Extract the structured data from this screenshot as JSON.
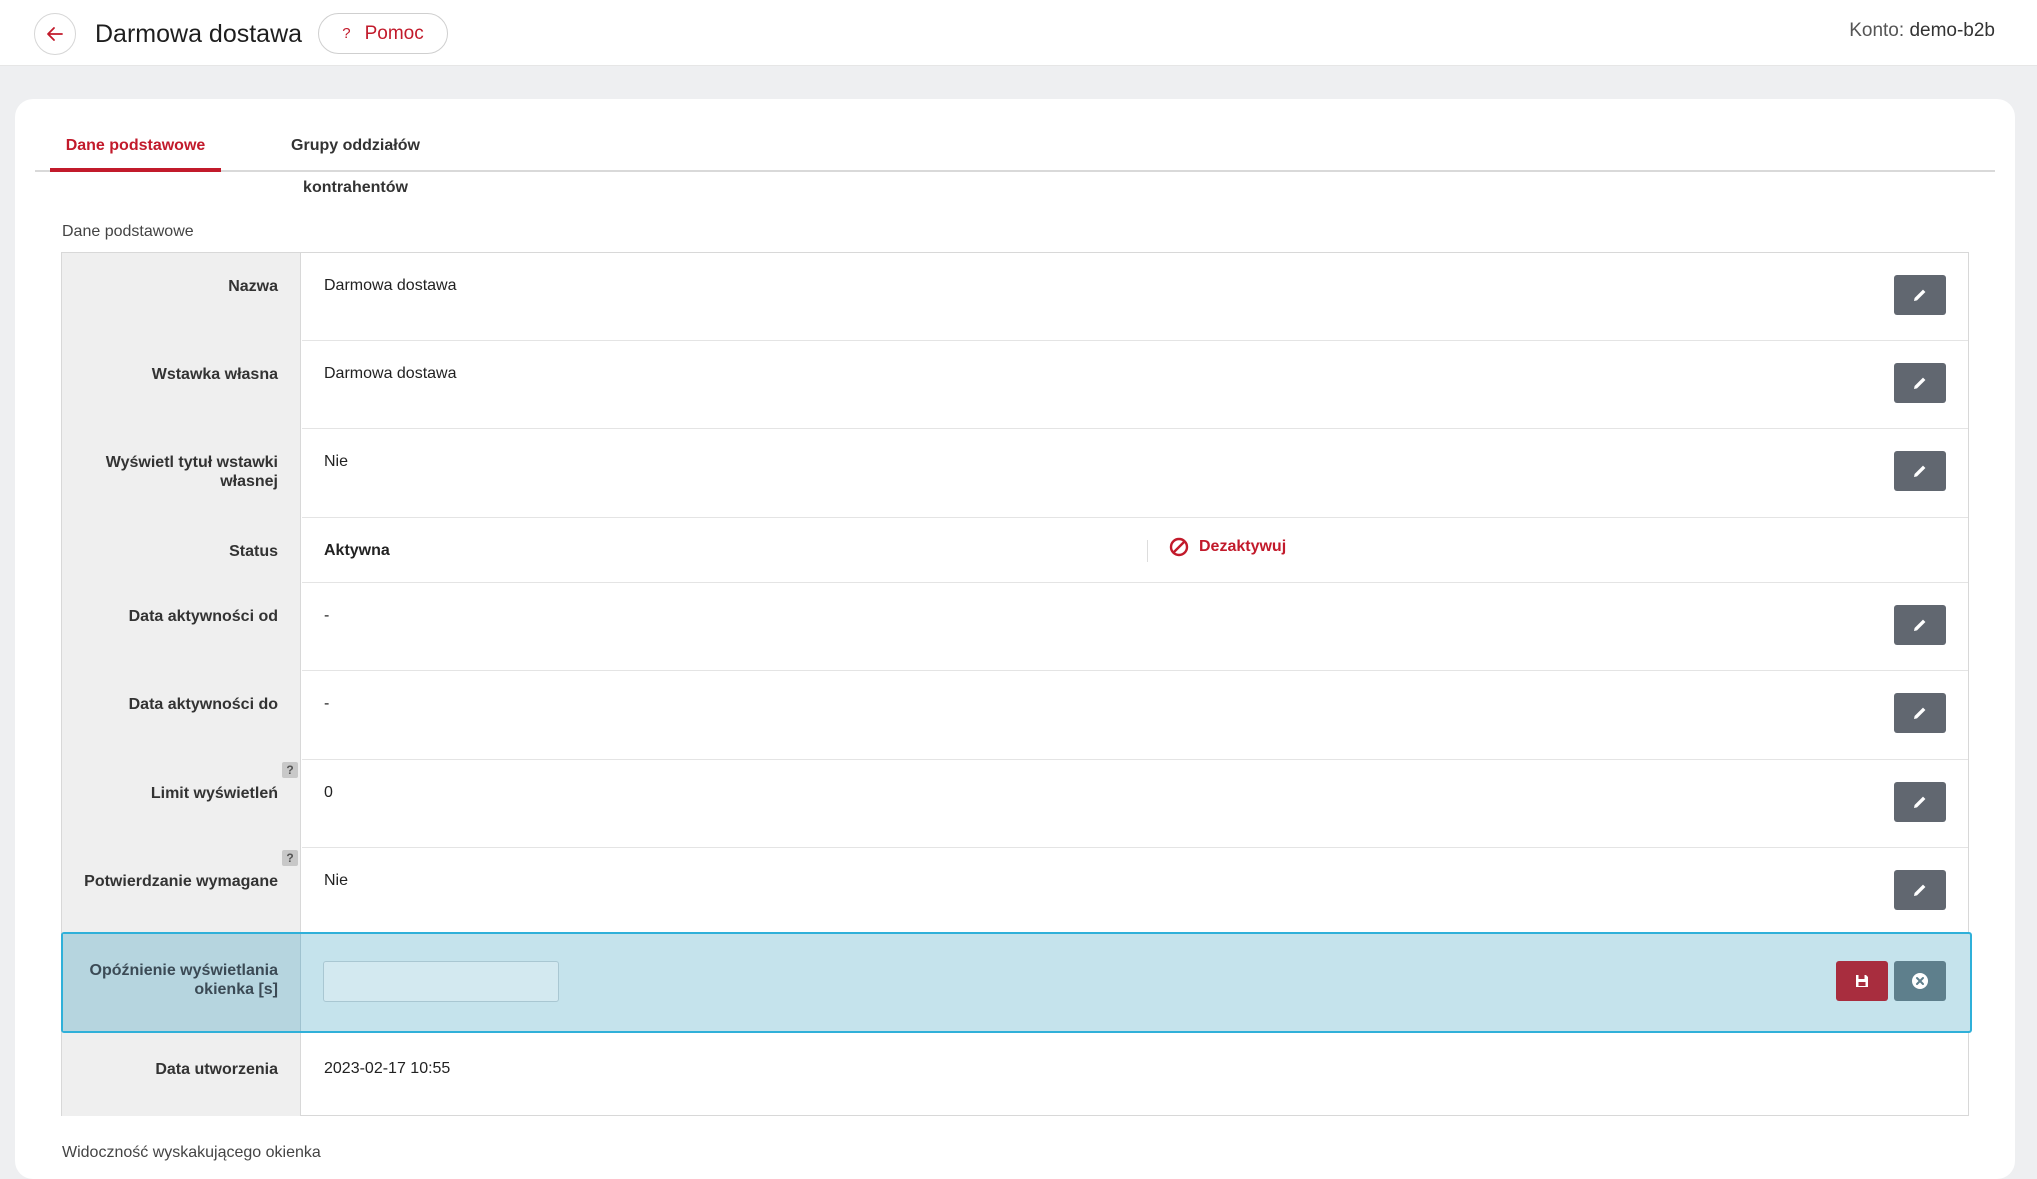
{
  "header": {
    "title": "Darmowa dostawa",
    "help_label": "Pomoc",
    "help_icon": "?",
    "account_label": "Konto:",
    "account_value": "demo-b2b"
  },
  "tabs": [
    {
      "label": "Dane podstawowe",
      "active": true
    },
    {
      "label": "Grupy oddziałów kontrahentów",
      "active": false
    }
  ],
  "section": {
    "title": "Dane podstawowe",
    "next_title": "Widoczność wyskakującego okienka"
  },
  "rows": {
    "nazwa": {
      "label": "Nazwa",
      "value": "Darmowa dostawa"
    },
    "wstawka": {
      "label": "Wstawka własna",
      "value": "Darmowa dostawa"
    },
    "tytul": {
      "label": "Wyświetl tytuł wstawki własnej",
      "value": "Nie"
    },
    "status": {
      "label": "Status",
      "value": "Aktywna",
      "action": "Dezaktywuj"
    },
    "data_od": {
      "label": "Data aktywności od",
      "value": "-"
    },
    "data_do": {
      "label": "Data aktywności do",
      "value": "-"
    },
    "limit": {
      "label": "Limit wyświetleń",
      "value": "0",
      "help": "?"
    },
    "potwierdzanie": {
      "label": "Potwierdzanie wymagane",
      "value": "Nie",
      "help": "?"
    },
    "opoznienie": {
      "label": "Opóźnienie wyświetlania okienka [s]",
      "value": ""
    },
    "utworzenie": {
      "label": "Data utworzenia",
      "value": "2023-02-17 10:55"
    }
  },
  "colors": {
    "brand_red": "#c21a2b",
    "edit_button": "#616770",
    "editing_row_bg": "#c5e3ec",
    "editing_row_border": "#2fb0d9"
  },
  "icons": {
    "back": "arrow-left-icon",
    "edit": "pencil-icon",
    "save": "floppy-disk-icon",
    "cancel": "close-circle-icon",
    "deactivate": "ban-icon"
  }
}
